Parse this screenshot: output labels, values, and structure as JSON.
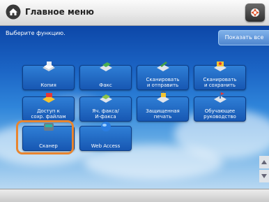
{
  "header": {
    "title": "Главное меню"
  },
  "main": {
    "instruction": "Выберите функцию.",
    "show_all_label": "Показать все",
    "functions": [
      {
        "label": "Копия",
        "icon": "copy-icon"
      },
      {
        "label": "Факс",
        "icon": "fax-icon"
      },
      {
        "label": "Сканировать\nи отправить",
        "icon": "scan-send-icon"
      },
      {
        "label": "Сканировать\nи сохранить",
        "icon": "scan-store-icon"
      },
      {
        "label": "Доступ к\nсохр. файлам",
        "icon": "stored-files-icon"
      },
      {
        "label": "Яч. факса/\nИ-факса",
        "icon": "fax-inbox-icon"
      },
      {
        "label": "Защищенная\nпечать",
        "icon": "secure-print-icon"
      },
      {
        "label": "Обучающее\nруководство",
        "icon": "tutorial-icon"
      },
      {
        "label": "Сканер",
        "icon": "scanner-icon",
        "selected": true
      },
      {
        "label": "Web Access",
        "icon": "web-access-icon"
      }
    ]
  },
  "colors": {
    "accent_highlight": "#e8852f",
    "tile_blue": "#1757b2",
    "background_blue": "#1c66c6"
  }
}
